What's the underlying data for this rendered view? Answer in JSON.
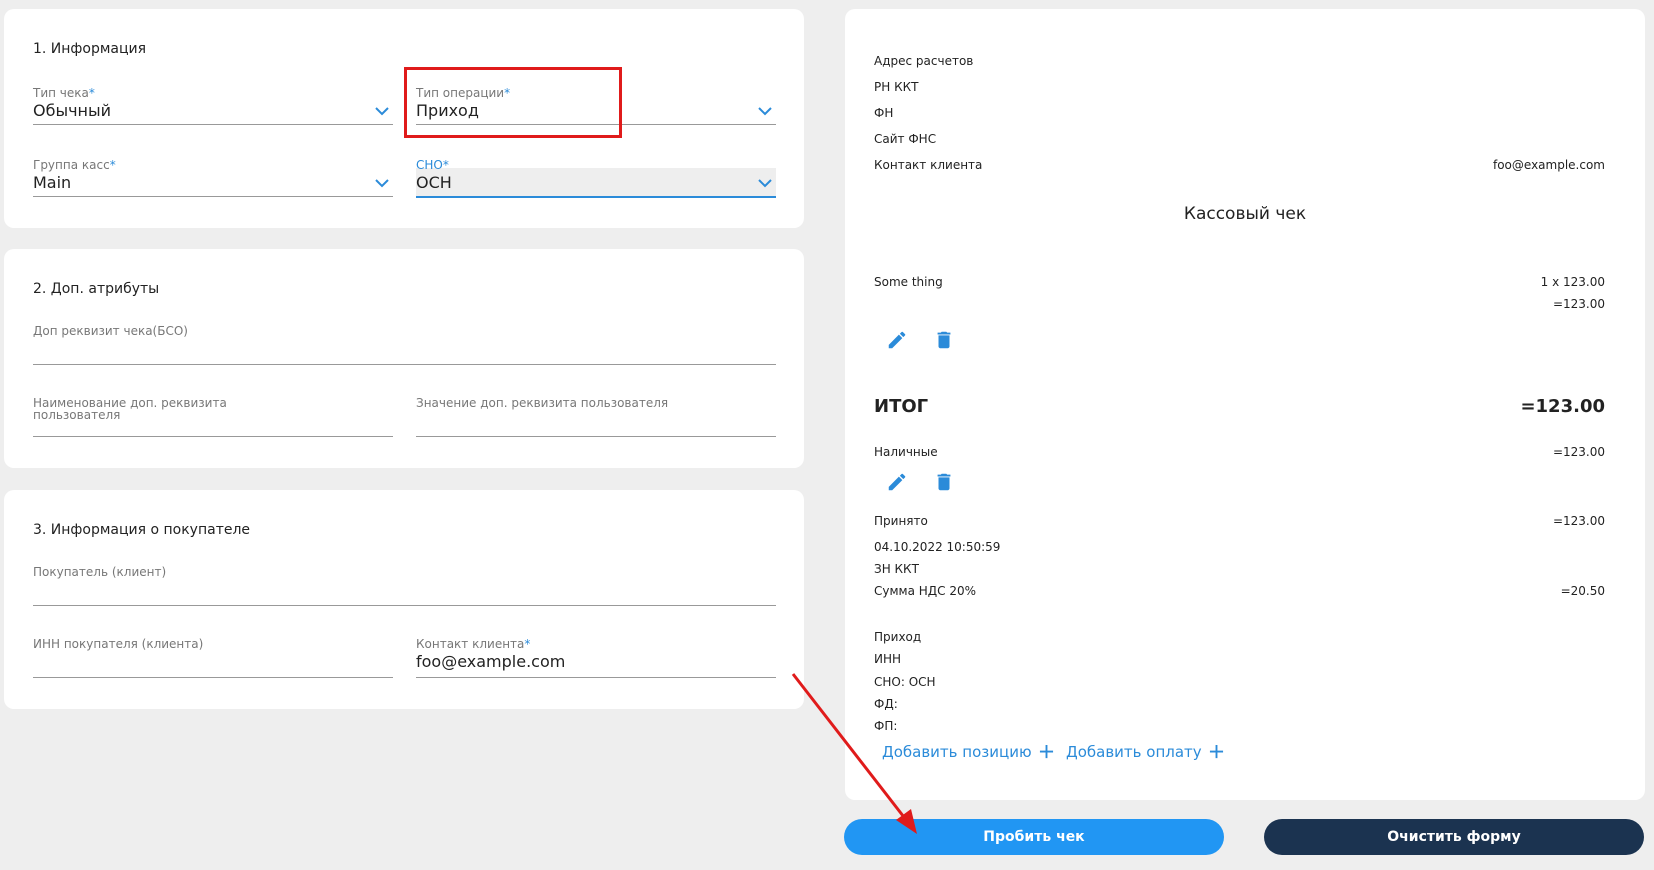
{
  "colors": {
    "accent": "#2b8bd9",
    "primary_button": "#2196f3",
    "dark_button": "#1b3350",
    "annotation": "#e01b1b"
  },
  "info": {
    "title": "1. Информация",
    "receipt_type": {
      "label": "Тип чека",
      "value": "Обычный"
    },
    "operation_type": {
      "label": "Тип операции",
      "value": "Приход"
    },
    "register_group": {
      "label": "Группа касс",
      "value": "Main"
    },
    "tax_system": {
      "label": "СНО",
      "value": "ОСН"
    },
    "required_mark": "*"
  },
  "extra": {
    "title": "2. Доп. атрибуты",
    "bso_label": "Доп реквизит чека(БСО)",
    "user_attr_name_label": "Наименование доп. реквизита пользователя",
    "user_attr_value_label": "Значение доп. реквизита пользователя"
  },
  "buyer": {
    "title": "3. Информация о покупателе",
    "buyer_label": "Покупатель (клиент)",
    "inn_label": "ИНН покупателя (клиента)",
    "contact_label": "Контакт клиента",
    "contact_value": "foo@example.com"
  },
  "receipt": {
    "settle_address": "Адрес расчетов",
    "rn_kkt": "РН ККТ",
    "fn": "ФН",
    "fns_site": "Сайт ФНС",
    "client_contact_label": "Контакт клиента",
    "client_contact_value": "foo@example.com",
    "title": "Кассовый чек",
    "item_name": "Some thing",
    "item_qty": "1 x 123.00",
    "item_sum": "=123.00",
    "total_label": "ИТОГ",
    "total_value": "=123.00",
    "payment_label": "Наличные",
    "payment_value": "=123.00",
    "accepted_label": "Принято",
    "accepted_value": "=123.00",
    "datetime": "04.10.2022 10:50:59",
    "zn_kkt": "ЗН ККТ",
    "vat_label": "Сумма НДС 20%",
    "vat_value": "=20.50",
    "op_type": "Приход",
    "inn": "ИНН",
    "sno": "СНО: ОСН",
    "fd": "ФД:",
    "fp": "ФП:",
    "add_position": "Добавить позицию",
    "add_payment": "Добавить оплату"
  },
  "actions": {
    "submit": "Пробить чек",
    "clear": "Очистить форму"
  },
  "icons": {
    "edit": "pencil-icon",
    "delete": "trash-icon",
    "add": "plus-icon",
    "dropdown": "chevron-down-icon"
  }
}
